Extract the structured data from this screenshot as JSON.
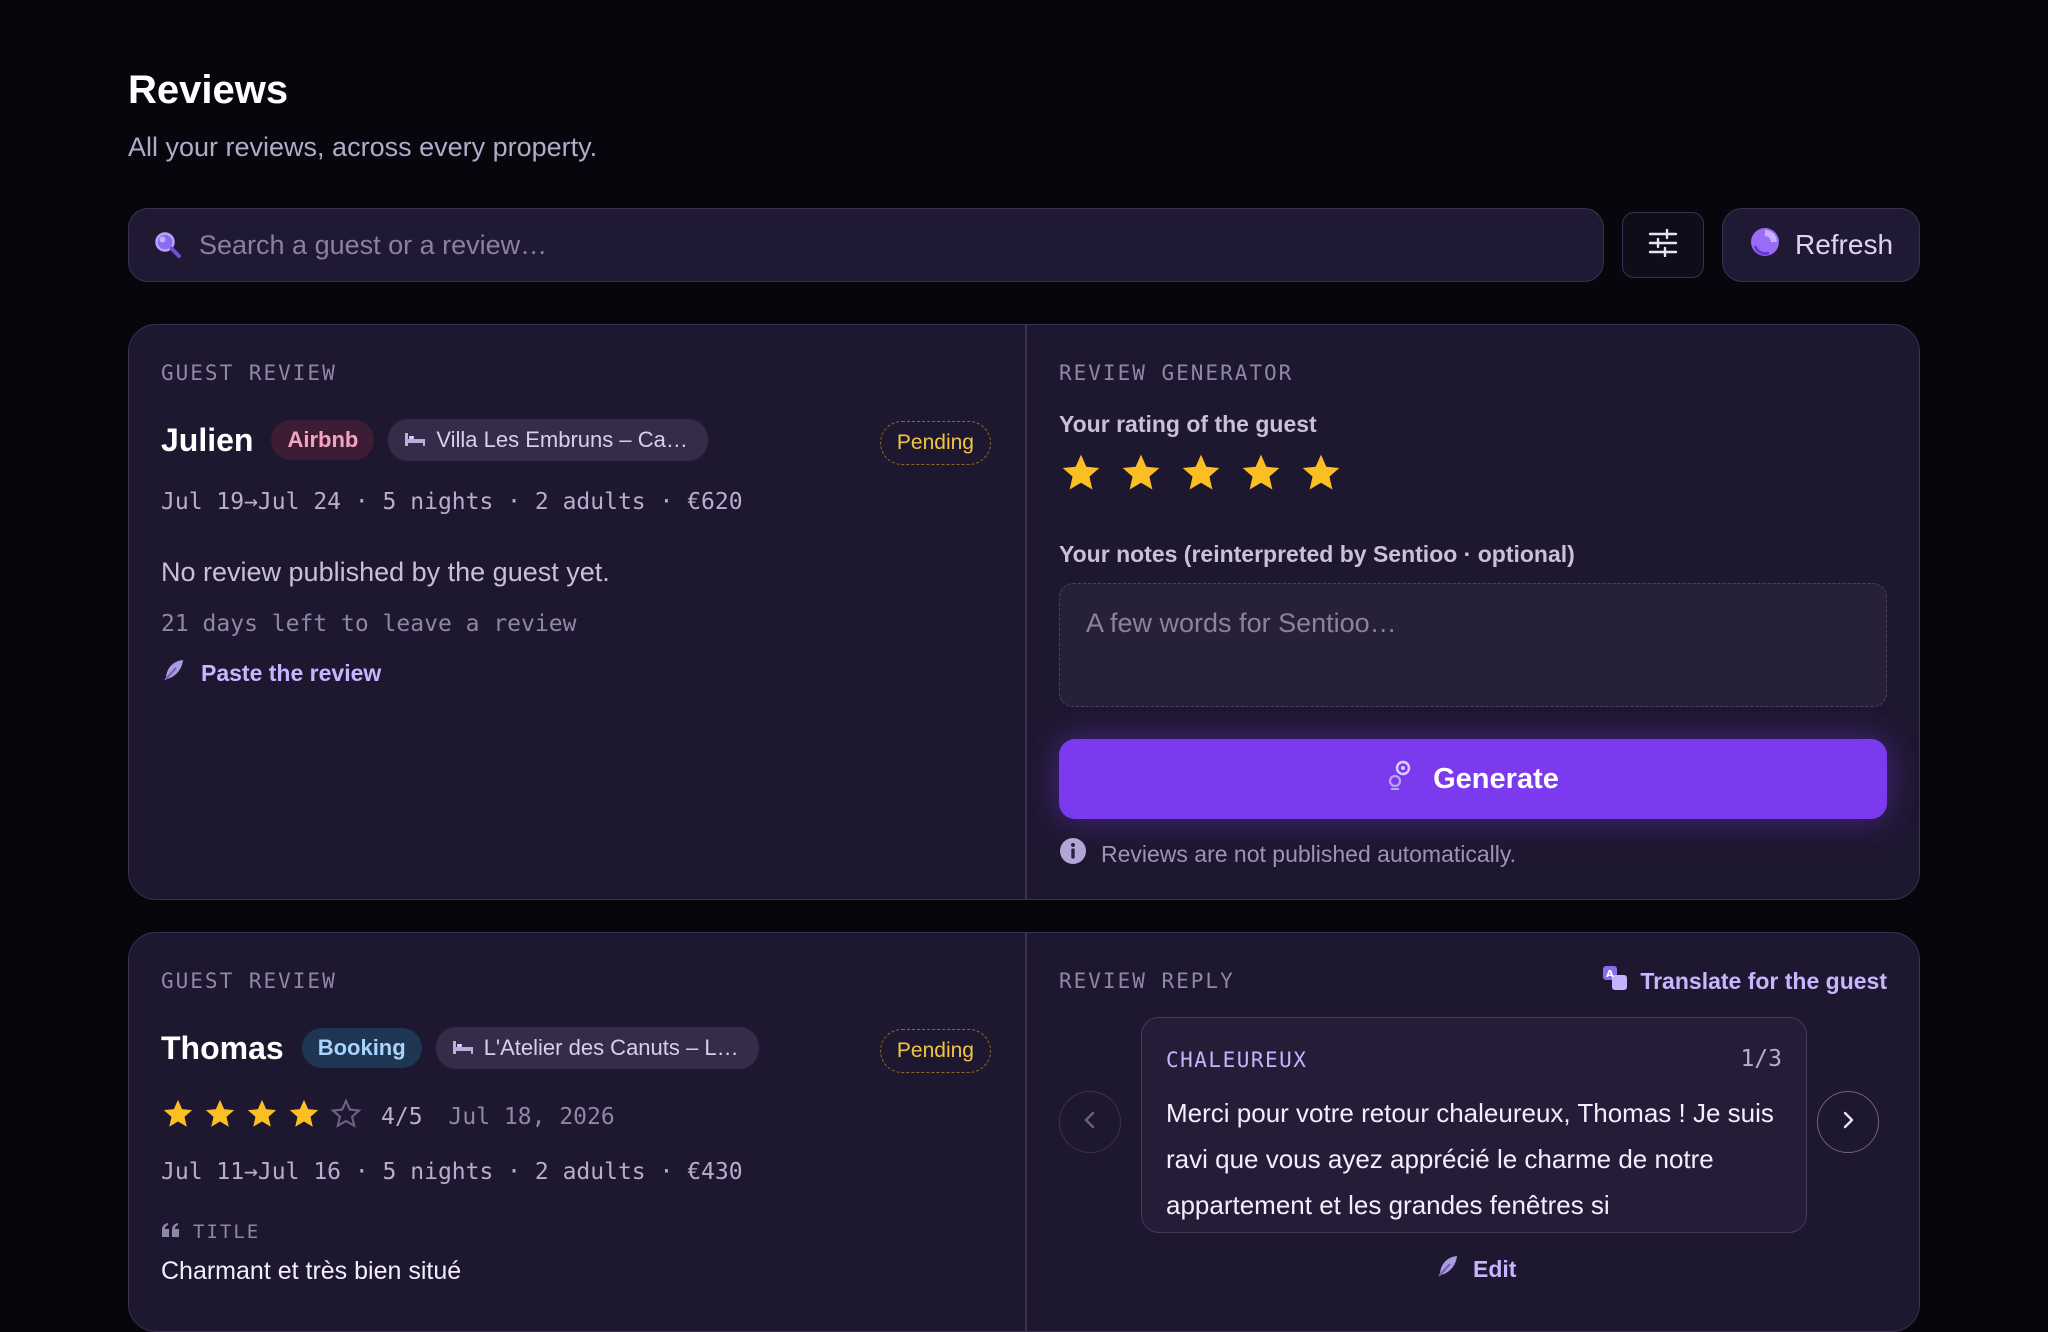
{
  "header": {
    "title": "Reviews",
    "subtitle": "All your reviews, across every property."
  },
  "search": {
    "placeholder": "Search a guest or a review…",
    "value": ""
  },
  "toolbar": {
    "filter_icon": "sliders-icon",
    "refresh_label": "Refresh"
  },
  "reviews": [
    {
      "section_label": "GUEST REVIEW",
      "guest_name": "Julien",
      "platform": "Airbnb",
      "property": "Villa Les Embruns – Ca…",
      "status": "Pending",
      "stay": "Jul 19→Jul 24 · 5 nights · 2 adults · €620",
      "empty_message": "No review published by the guest yet.",
      "days_left": "21 days left to leave a review",
      "paste_label": "Paste the review",
      "generator": {
        "section_label": "REVIEW GENERATOR",
        "rating_label": "Your rating of the guest",
        "rating": 5,
        "rating_max": 5,
        "notes_label": "Your notes (reinterpreted by Sentioo · optional)",
        "notes_placeholder": "A few words for Sentioo…",
        "generate_label": "Generate",
        "info": "Reviews are not published automatically."
      }
    },
    {
      "section_label": "GUEST REVIEW",
      "guest_name": "Thomas",
      "platform": "Booking",
      "property": "L'Atelier des Canuts – L…",
      "status": "Pending",
      "rating": 4,
      "rating_max": 5,
      "rating_text": "4/5",
      "review_date": "Jul 18, 2026",
      "stay": "Jul 11→Jul 16 · 5 nights · 2 adults · €430",
      "title_label": "TITLE",
      "review_title": "Charmant et très bien situé",
      "reply": {
        "section_label": "REVIEW REPLY",
        "translate_label": "Translate for the guest",
        "tone": "CHALEUREUX",
        "counter": "1/3",
        "text": "Merci pour votre retour chaleureux, Thomas ! Je suis ravi que vous ayez apprécié le charme de notre appartement et les grandes fenêtres si",
        "edit_label": "Edit"
      }
    }
  ],
  "colors": {
    "background": "#08060d",
    "card": "#1e1730",
    "accent": "#7b3aed",
    "star": "#fbbf24",
    "pending": "#f5c542",
    "link": "#c7b6ff"
  }
}
